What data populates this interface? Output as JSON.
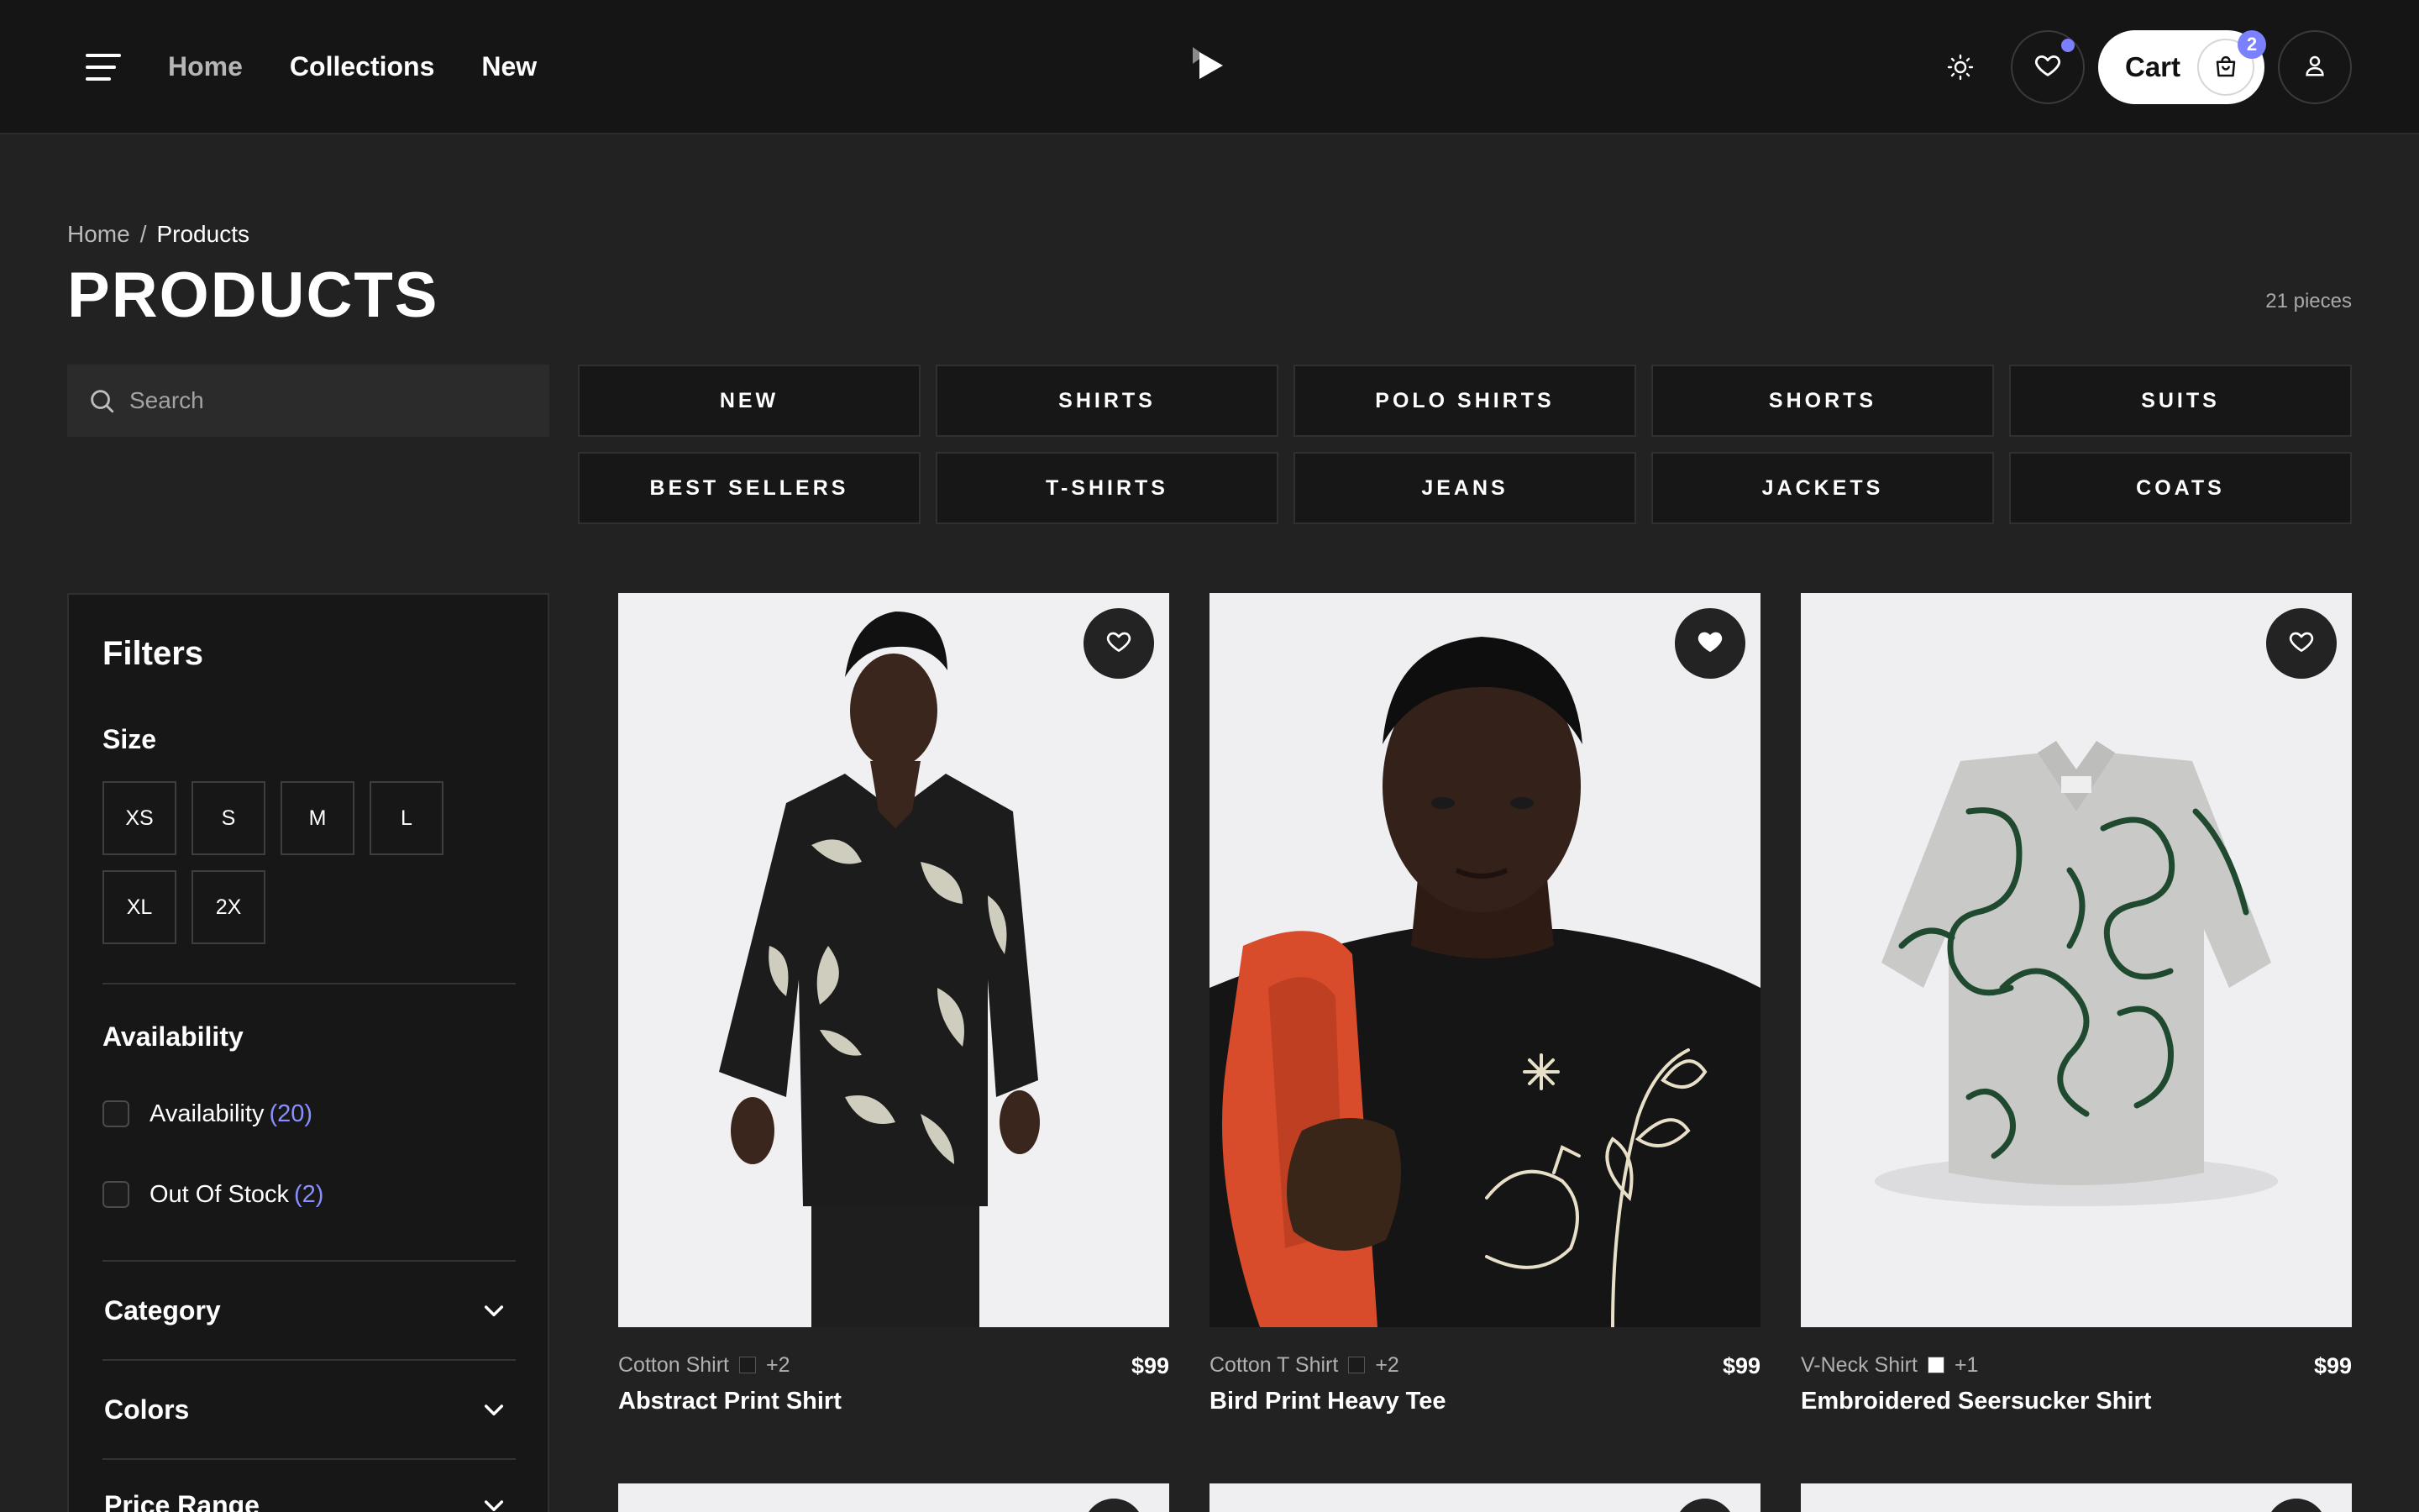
{
  "nav": {
    "links": [
      "Home",
      "Collections",
      "New"
    ]
  },
  "header": {
    "cart_label": "Cart",
    "cart_count": "2",
    "icons": [
      "menu-icon",
      "play-logo-icon",
      "sun-icon",
      "heart-icon",
      "shopping-bag-icon",
      "user-icon"
    ],
    "accent_color": "#7b80ff"
  },
  "breadcrumb": {
    "home": "Home",
    "separator": "/",
    "current": "Products"
  },
  "page": {
    "title": "PRODUCTS",
    "count": "21 pieces"
  },
  "search": {
    "placeholder": "Search"
  },
  "categories": [
    "NEW",
    "SHIRTS",
    "POLO SHIRTS",
    "SHORTS",
    "SUITS",
    "BEST SELLERS",
    "T-SHIRTS",
    "JEANS",
    "JACKETS",
    "COATS"
  ],
  "filters": {
    "title": "Filters",
    "size_title": "Size",
    "sizes": [
      "XS",
      "S",
      "M",
      "L",
      "XL",
      "2X"
    ],
    "availability_title": "Availability",
    "availability": [
      {
        "label": "Availability",
        "count": "(20)"
      },
      {
        "label": "Out Of Stock",
        "count": "(2)"
      }
    ],
    "sections": [
      "Category",
      "Colors",
      "Price Range"
    ]
  },
  "products": [
    {
      "type": "Cotton Shirt",
      "swatch_color": "#1b1b1b",
      "more_colors": "+2",
      "price": "$99",
      "name": "Abstract Print Shirt",
      "favorited": false
    },
    {
      "type": "Cotton T Shirt",
      "swatch_color": "#1b1b1b",
      "more_colors": "+2",
      "price": "$99",
      "name": "Bird Print Heavy Tee",
      "favorited": true
    },
    {
      "type": "V-Neck Shirt",
      "swatch_color": "#ffffff",
      "more_colors": "+1",
      "price": "$99",
      "name": "Embroidered Seersucker Shirt",
      "favorited": false
    }
  ]
}
